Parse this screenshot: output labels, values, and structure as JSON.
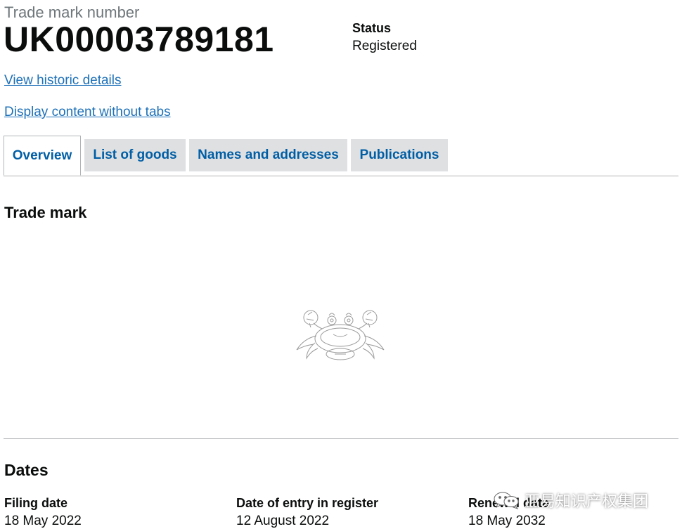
{
  "header": {
    "caption": "Trade mark number",
    "number": "UK00003789181",
    "status_label": "Status",
    "status_value": "Registered"
  },
  "links": {
    "historic": "View historic details",
    "no_tabs": "Display content without tabs"
  },
  "tabs": [
    {
      "label": "Overview",
      "active": true
    },
    {
      "label": "List of goods",
      "active": false
    },
    {
      "label": "Names and addresses",
      "active": false
    },
    {
      "label": "Publications",
      "active": false
    }
  ],
  "trade_mark_section": {
    "heading": "Trade mark",
    "image_icon": "crab-toy-drawing"
  },
  "dates_section": {
    "heading": "Dates",
    "items": [
      {
        "label": "Filing date",
        "value": "18 May 2022"
      },
      {
        "label": "Date of entry in register",
        "value": "12 August 2022"
      },
      {
        "label": "Renewal date",
        "value": "18 May 2032"
      }
    ]
  },
  "watermark": {
    "text": "亚易知识产权集团",
    "icon": "wechat-icon"
  },
  "colors": {
    "link": "#1d70b8",
    "tab_text": "#005ea5",
    "tab_bg": "#dee0e2",
    "caption": "#6f777b",
    "border": "#b1b4b6"
  }
}
